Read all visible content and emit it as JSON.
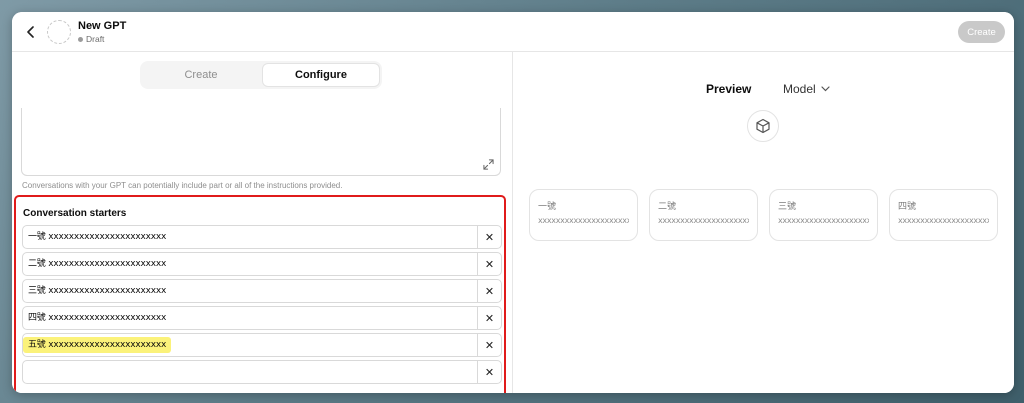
{
  "header": {
    "title": "New GPT",
    "status": "Draft",
    "create_button": "Create"
  },
  "tabs": [
    {
      "label": "Create"
    },
    {
      "label": "Configure"
    }
  ],
  "instructions_hint": "Conversations with your GPT can potentially include part or all of the instructions provided.",
  "starters": {
    "title": "Conversation starters",
    "items": [
      {
        "value": "一號 xxxxxxxxxxxxxxxxxxxxxxx"
      },
      {
        "value": "二號 xxxxxxxxxxxxxxxxxxxxxxx"
      },
      {
        "value": "三號 xxxxxxxxxxxxxxxxxxxxxxx"
      },
      {
        "value": "四號 xxxxxxxxxxxxxxxxxxxxxxx"
      },
      {
        "value": "五號 xxxxxxxxxxxxxxxxxxxxxxx"
      },
      {
        "value": ""
      }
    ],
    "delete_glyph": "✕"
  },
  "preview": {
    "label": "Preview",
    "model_label": "Model",
    "cards": [
      {
        "title": "一號",
        "sub": "xxxxxxxxxxxxxxxxxxxxxxx"
      },
      {
        "title": "二號",
        "sub": "xxxxxxxxxxxxxxxxxxxxxxx"
      },
      {
        "title": "三號",
        "sub": "xxxxxxxxxxxxxxxxxxxxxxx"
      },
      {
        "title": "四號",
        "sub": "xxxxxxxxxxxxxxxxxxxxxxx"
      }
    ]
  },
  "colors": {
    "highlight": "#fbf27a",
    "annotation_border": "#e01b1b",
    "disabled_button": "#c9c9c9"
  },
  "icons": [
    "chevron-left-icon",
    "expand-icon",
    "cube-icon",
    "chevron-down-icon",
    "close-icon"
  ]
}
